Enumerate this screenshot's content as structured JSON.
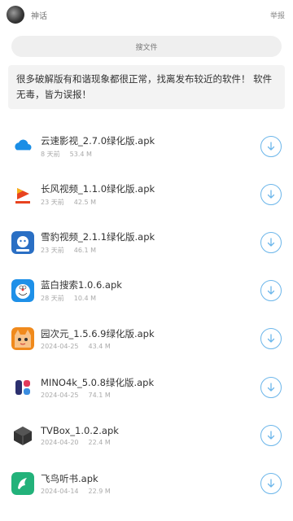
{
  "header": {
    "title": "神话",
    "report_label": "举报"
  },
  "search": {
    "label": "搜文件"
  },
  "notice": {
    "text": "很多破解版有和谐现象都很正常，找离发布较近的软件！ 软件无毒，皆为误报！"
  },
  "files": [
    {
      "name": "云速影视_2.7.0绿化版.apk",
      "date": "8 天前",
      "size": "53.4 M",
      "icon": "cloud-app-icon",
      "color": "#1a8ee6"
    },
    {
      "name": "长风视频_1.1.0绿化版.apk",
      "date": "23 天前",
      "size": "42.5 M",
      "icon": "play-app-icon",
      "color": "#e8431f"
    },
    {
      "name": "雪豹视频_2.1.1绿化版.apk",
      "date": "23 天前",
      "size": "46.1 M",
      "icon": "leopard-app-icon",
      "color": "#2a6fc4"
    },
    {
      "name": "蓝白搜索1.0.6.apk",
      "date": "28 天前",
      "size": "10.4 M",
      "icon": "doraemon-app-icon",
      "color": "#1e90e8"
    },
    {
      "name": "园次元_1.5.6.9绿化版.apk",
      "date": "2024-04-25",
      "size": "43.4 M",
      "icon": "anime-app-icon",
      "color": "#f08a1c"
    },
    {
      "name": "MINO4k_5.0.8绿化版.apk",
      "date": "2024-04-25",
      "size": "74.1 M",
      "icon": "mino-app-icon",
      "color": "#2b2f6e"
    },
    {
      "name": "TVBox_1.0.2.apk",
      "date": "2024-04-20",
      "size": "22.4 M",
      "icon": "cube-app-icon",
      "color": "#333333"
    },
    {
      "name": "飞鸟听书.apk",
      "date": "2024-04-14",
      "size": "22.9 M",
      "icon": "bird-app-icon",
      "color": "#22b27a"
    }
  ],
  "colors": {
    "accent": "#6cb6ea",
    "notice_bg": "#f3f3f3",
    "search_bg": "#efefef"
  }
}
